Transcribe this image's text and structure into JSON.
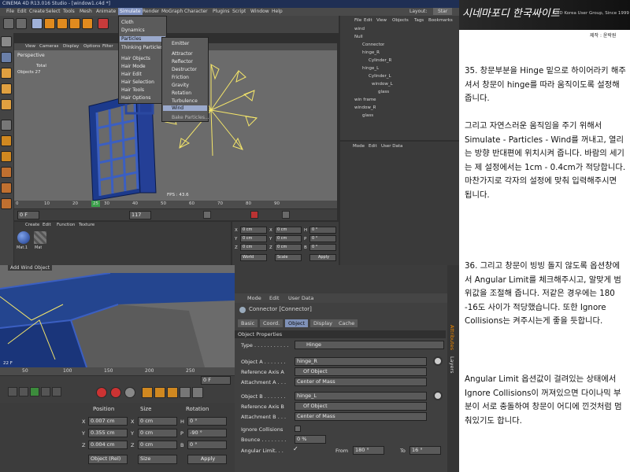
{
  "window": {
    "title": "CINEMA 4D R13.016 Studio - [window1.c4d *]"
  },
  "menubar": [
    "File",
    "Edit",
    "Create",
    "Select",
    "Tools",
    "Mesh",
    "Animate",
    "Simulate",
    "Render",
    "MoGraph",
    "Character",
    "Plugins",
    "Script",
    "Window",
    "Help"
  ],
  "layout_field": "Layout:",
  "layout_value": "Star",
  "simulate_menu": {
    "items": [
      "Cloth",
      "Dynamics",
      "Particles",
      "Thinking Particles",
      "",
      "Hair Objects",
      "Hair Mode",
      "Hair Edit",
      "Hair Selection",
      "Hair Tools",
      "Hair Options"
    ],
    "highlight": "Particles"
  },
  "particles_submenu": {
    "items": [
      "Emitter",
      "Attractor",
      "Reflector",
      "Destructor",
      "Friction",
      "Gravity",
      "Rotation",
      "Turbulence",
      "Wind",
      "Bake Particles..."
    ],
    "highlight": "Wind"
  },
  "viewport": {
    "menu": [
      "View",
      "Cameras",
      "Display",
      "Options",
      "Filter"
    ],
    "label": "Perspective",
    "stats_label": "Total",
    "stats_row": "Objects   27",
    "fps": "FPS : 43.6"
  },
  "timeline": {
    "ticks": [
      "0",
      "10",
      "20",
      "30",
      "40",
      "50",
      "60",
      "70",
      "80",
      "90"
    ],
    "current": "25",
    "frame_start": "0 F",
    "frame_end": "90 F",
    "frame_field": "117"
  },
  "material": {
    "menu": [
      "Create",
      "Edit",
      "Function",
      "Texture"
    ],
    "swatches": [
      "Mat.1",
      "Mat"
    ]
  },
  "coords_small": {
    "rows": [
      [
        "X",
        "0 cm",
        "X",
        "0 cm",
        "H",
        "0 °"
      ],
      [
        "Y",
        "0 cm",
        "Y",
        "0 cm",
        "P",
        "0 °"
      ],
      [
        "Z",
        "0 cm",
        "Z",
        "0 cm",
        "B",
        "0 °"
      ]
    ],
    "buttons": [
      "World",
      "Scale",
      "Apply"
    ]
  },
  "object_manager": {
    "menu": [
      "File",
      "Edit",
      "View",
      "Objects",
      "Tags",
      "Bookmarks"
    ],
    "items": [
      "wind",
      "Null",
      "Connector",
      "hinge_R",
      "Cylinder_R",
      "hinge_L",
      "Cylinder_L",
      "window_L",
      "glass",
      "win frame",
      "window_R",
      "glass"
    ]
  },
  "attr_top": {
    "menu": [
      "Mode",
      "Edit",
      "User Data"
    ]
  },
  "lower_viewport": {
    "label": "Add Wind Object",
    "tick": "22 F"
  },
  "lower_timeline": {
    "ticks": [
      "50",
      "100",
      "150",
      "200",
      "250"
    ],
    "frame_field": "0 F"
  },
  "coords": {
    "headers": [
      "Position",
      "Size",
      "Rotation"
    ],
    "rows": [
      [
        "X",
        "0.007 cm",
        "X",
        "0 cm",
        "H",
        "0 °"
      ],
      [
        "Y",
        "0.355 cm",
        "Y",
        "0 cm",
        "P",
        "-90 °"
      ],
      [
        "Z",
        "0.004 cm",
        "Z",
        "0 cm",
        "B",
        "0 °"
      ]
    ],
    "mode": "Object (Rel)",
    "size_mode": "Size",
    "apply": "Apply"
  },
  "attributes": {
    "menu": [
      "Mode",
      "Edit",
      "User Data"
    ],
    "title": "Connector [Connector]",
    "tabs": [
      "Basic",
      "Coord.",
      "Object",
      "Display",
      "Cache"
    ],
    "active_tab": "Object",
    "section": "Object Properties",
    "type_label": "Type . . . . . . . . . . .",
    "type_value": "Hinge",
    "object_a_label": "Object A . . . . . . .",
    "object_a_value": "hinge_R",
    "ref_axis_a_label": "Reference Axis A",
    "ref_axis_a_value": "Of Object",
    "attach_a_label": "Attachment A . . .",
    "attach_a_value": "Center of Mass",
    "object_b_label": "Object B . . . . . . .",
    "object_b_value": "hinge_L",
    "ref_axis_b_label": "Reference Axis B",
    "ref_axis_b_value": "Of Object",
    "attach_b_label": "Attachment B . . .",
    "attach_b_value": "Center of Mass",
    "ignore_label": "Ignore Collisions",
    "bounce_label": "Bounce . . . . . . . .",
    "bounce_value": "0 %",
    "angular_label": "Angular Limit. . .",
    "from_label": "From",
    "from_value": "180 °",
    "to_label": "To",
    "to_value": "16 °",
    "side_tabs": [
      "Attributes",
      "Layers"
    ]
  },
  "lower_attr_menu": {
    "menu": [
      "Mode",
      "Edit",
      "User Data"
    ]
  },
  "header_banner": {
    "title": "시네마포디 한국싸이트",
    "subtitle": "C4D Korea User Group, Since 1999",
    "credit": "제작 : 윤락원"
  },
  "instructions": [
    "35. 창문부분을 Hinge 밑으로 하이어라키 해주셔서 창문이 hinge를 따라 움직이도록 설정해 줍니다.",
    "그리고 자연스러운 움직임을 주기 위해서 Simulate - Particles - Wind를 꺼내고, 열리는 방향 반대편에 위치시켜 줍니다. 바람의 세기는 제 설정에서는 1cm - 0.4cm가 적당합니다. 마찬가지로 각자의 설정에 맞춰 입력해주시면 됩니다.",
    "36. 그리고 창문이 빙빙 돌지 않도록 옵션창에서 Angular Limit를 체크해주시고, 알맞게 범위값을 조절해 줍니다. 저같은 경우에는 180 -16도 사이가 적당했습니다. 또한 Ignore Collisions는 켜주시는게 좋을 듯합니다.",
    "Angular Limit 옵션값이 걸려있는 상태에서 Ignore Collisions이 꺼져있으면 다이나믹 부분이 서로 충돌하여 창문이 어디에 낀것처럼 멈춰있기도 합니다."
  ],
  "colors": {
    "bg": "#3a3a3a",
    "panel": "#404040",
    "accent_orange": "#f28a00",
    "highlight_blue": "#5a7cc4",
    "window_blue": "#2a48a0",
    "wind_yellow": "#f5e66a",
    "text_panel": "#ffffff"
  }
}
